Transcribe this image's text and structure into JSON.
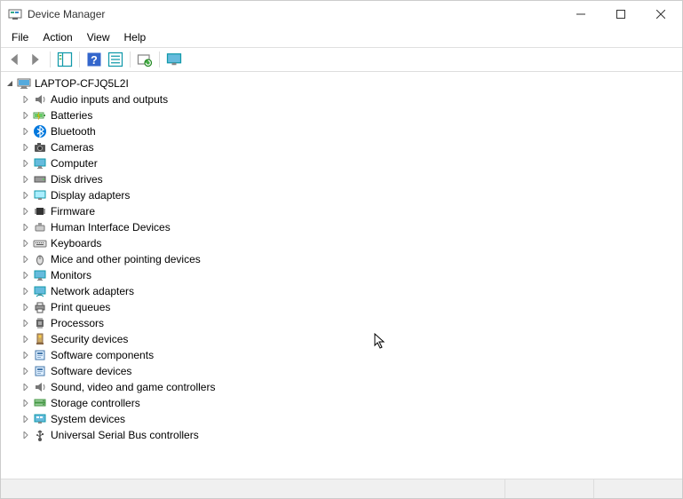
{
  "window": {
    "title": "Device Manager"
  },
  "menu": {
    "items": [
      "File",
      "Action",
      "View",
      "Help"
    ]
  },
  "toolbar": {
    "back": "Back",
    "forward": "Forward",
    "show_hide": "Show/Hide Console Tree",
    "help": "Help",
    "action_menu": "Action",
    "scan": "Scan for hardware changes",
    "monitor": "View"
  },
  "tree": {
    "root": {
      "label": "LAPTOP-CFJQ5L2I",
      "expanded": true,
      "icon": "computer-icon"
    },
    "children": [
      {
        "label": "Audio inputs and outputs",
        "icon": "speaker-icon"
      },
      {
        "label": "Batteries",
        "icon": "battery-icon"
      },
      {
        "label": "Bluetooth",
        "icon": "bluetooth-icon"
      },
      {
        "label": "Cameras",
        "icon": "camera-icon"
      },
      {
        "label": "Computer",
        "icon": "monitor-icon"
      },
      {
        "label": "Disk drives",
        "icon": "disk-icon"
      },
      {
        "label": "Display adapters",
        "icon": "display-icon"
      },
      {
        "label": "Firmware",
        "icon": "chip-icon"
      },
      {
        "label": "Human Interface Devices",
        "icon": "hid-icon"
      },
      {
        "label": "Keyboards",
        "icon": "keyboard-icon"
      },
      {
        "label": "Mice and other pointing devices",
        "icon": "mouse-icon"
      },
      {
        "label": "Monitors",
        "icon": "monitor-icon"
      },
      {
        "label": "Network adapters",
        "icon": "network-icon"
      },
      {
        "label": "Print queues",
        "icon": "printer-icon"
      },
      {
        "label": "Processors",
        "icon": "cpu-icon"
      },
      {
        "label": "Security devices",
        "icon": "security-icon"
      },
      {
        "label": "Software components",
        "icon": "software-icon"
      },
      {
        "label": "Software devices",
        "icon": "software-icon"
      },
      {
        "label": "Sound, video and game controllers",
        "icon": "speaker-icon"
      },
      {
        "label": "Storage controllers",
        "icon": "storage-icon"
      },
      {
        "label": "System devices",
        "icon": "system-icon"
      },
      {
        "label": "Universal Serial Bus controllers",
        "icon": "usb-icon"
      }
    ]
  }
}
